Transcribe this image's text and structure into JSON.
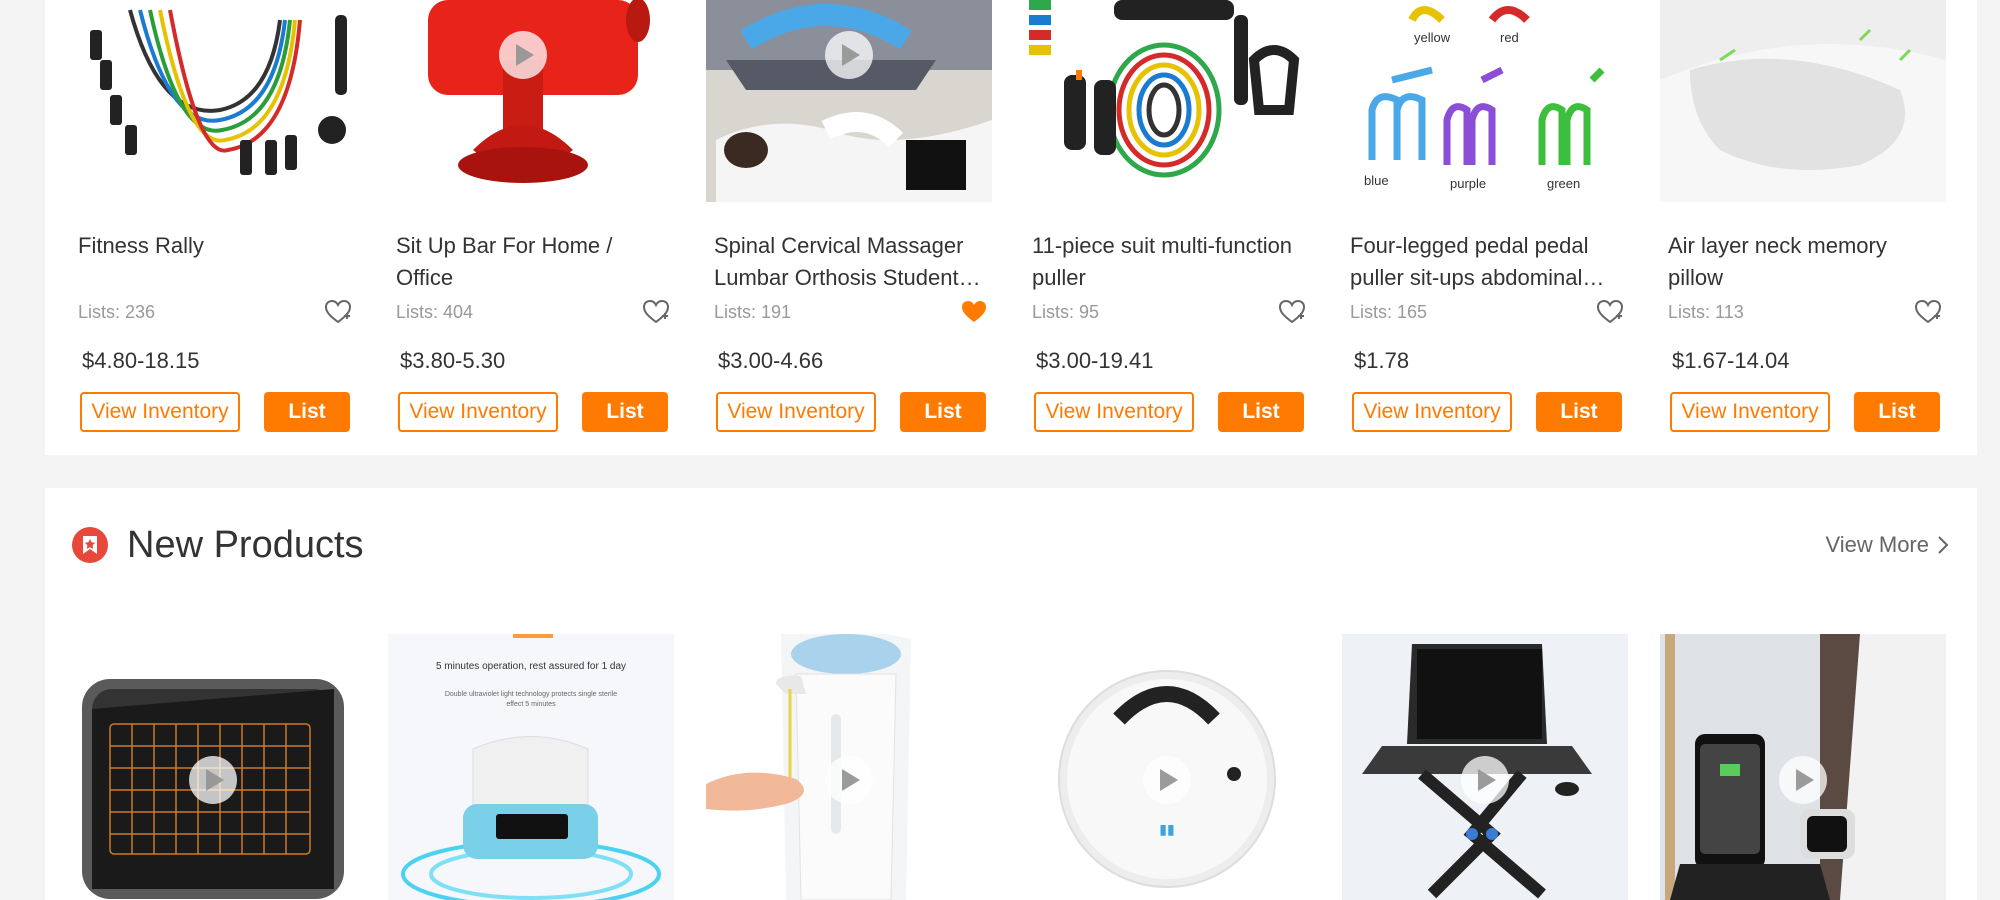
{
  "top_products": [
    {
      "title": "Fitness Rally",
      "lists": "Lists: 236",
      "price": "$4.80-18.15",
      "favorited": false,
      "image": "resistance-bands-image"
    },
    {
      "title": "Sit Up Bar For Home / Office",
      "lists": "Lists: 404",
      "price": "$3.80-5.30",
      "favorited": false,
      "image": "sit-up-bar-image"
    },
    {
      "title": "Spinal Cervical Massager Lumbar Orthosis Student…",
      "lists": "Lists: 191",
      "price": "$3.00-4.66",
      "favorited": true,
      "image": "back-stretcher-image"
    },
    {
      "title": "11-piece suit multi-function puller",
      "lists": "Lists: 95",
      "price": "$3.00-19.41",
      "favorited": false,
      "image": "resistance-band-set-image"
    },
    {
      "title": "Four-legged pedal pedal puller sit-ups abdominal…",
      "lists": "Lists: 165",
      "price": "$1.78",
      "favorited": false,
      "image": "pedal-puller-image"
    },
    {
      "title": "Air layer neck memory pillow",
      "lists": "Lists: 113",
      "price": "$1.67-14.04",
      "favorited": false,
      "image": "memory-pillow-image"
    }
  ],
  "buttons": {
    "view_inventory": "View Inventory",
    "list": "List"
  },
  "pedal_colors": {
    "yellow": "yellow",
    "red": "red",
    "blue": "blue",
    "purple": "purple",
    "green": "green"
  },
  "new_products": {
    "title": "New Products",
    "view_more": "View More",
    "items": [
      {
        "image": "wireless-keyboard-image"
      },
      {
        "image": "uv-sterilizer-box-image",
        "text_line1": "5 minutes operation, rest assured for 1 day",
        "text_line2": "Double ultraviolet light technology protects single sterile",
        "text_line3": "effect 5 minutes"
      },
      {
        "image": "soap-dispenser-image"
      },
      {
        "image": "robot-vacuum-image"
      },
      {
        "image": "laptop-stand-image"
      },
      {
        "image": "wireless-charging-stand-image"
      }
    ]
  },
  "colors": {
    "accent": "#ff7a00",
    "section_icon": "#e8473a",
    "text": "#333333",
    "muted": "#999999"
  }
}
